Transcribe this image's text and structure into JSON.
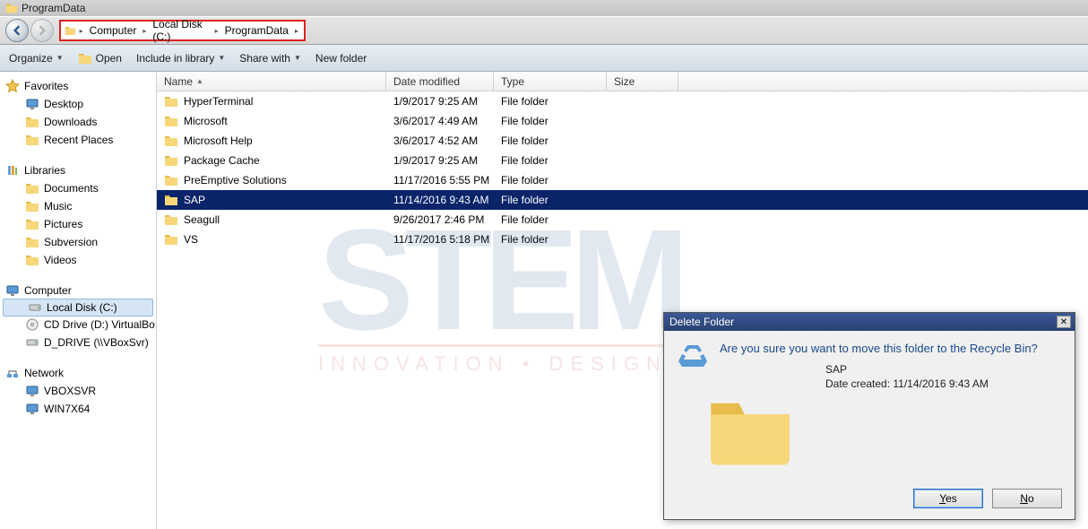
{
  "title": "ProgramData",
  "breadcrumb": [
    "Computer",
    "Local Disk (C:)",
    "ProgramData"
  ],
  "toolbar": {
    "organize": "Organize",
    "open": "Open",
    "include": "Include in library",
    "share": "Share with",
    "newfolder": "New folder"
  },
  "sidebar": {
    "favorites": {
      "label": "Favorites",
      "items": [
        "Desktop",
        "Downloads",
        "Recent Places"
      ]
    },
    "libraries": {
      "label": "Libraries",
      "items": [
        "Documents",
        "Music",
        "Pictures",
        "Subversion",
        "Videos"
      ]
    },
    "computer": {
      "label": "Computer",
      "items": [
        "Local Disk (C:)",
        "CD Drive (D:) VirtualBo",
        "D_DRIVE (\\\\VBoxSvr)"
      ]
    },
    "network": {
      "label": "Network",
      "items": [
        "VBOXSVR",
        "WIN7X64"
      ]
    }
  },
  "columns": [
    "Name",
    "Date modified",
    "Type",
    "Size"
  ],
  "files": [
    {
      "name": "HyperTerminal",
      "date": "1/9/2017 9:25 AM",
      "type": "File folder"
    },
    {
      "name": "Microsoft",
      "date": "3/6/2017 4:49 AM",
      "type": "File folder"
    },
    {
      "name": "Microsoft Help",
      "date": "3/6/2017 4:52 AM",
      "type": "File folder"
    },
    {
      "name": "Package Cache",
      "date": "1/9/2017 9:25 AM",
      "type": "File folder"
    },
    {
      "name": "PreEmptive Solutions",
      "date": "11/17/2016 5:55 PM",
      "type": "File folder"
    },
    {
      "name": "SAP",
      "date": "11/14/2016 9:43 AM",
      "type": "File folder",
      "selected": true
    },
    {
      "name": "Seagull",
      "date": "9/26/2017 2:46 PM",
      "type": "File folder"
    },
    {
      "name": "VS",
      "date": "11/17/2016 5:18 PM",
      "type": "File folder"
    }
  ],
  "watermark": {
    "logo": "STEM",
    "tagline": "INNOVATION   •   DESIGN   •   VALUE"
  },
  "dialog": {
    "title": "Delete Folder",
    "question": "Are you sure you want to move this folder to the Recycle Bin?",
    "item_name": "SAP",
    "item_date_label": "Date created: 11/14/2016 9:43 AM",
    "yes": "Yes",
    "no": "No"
  }
}
